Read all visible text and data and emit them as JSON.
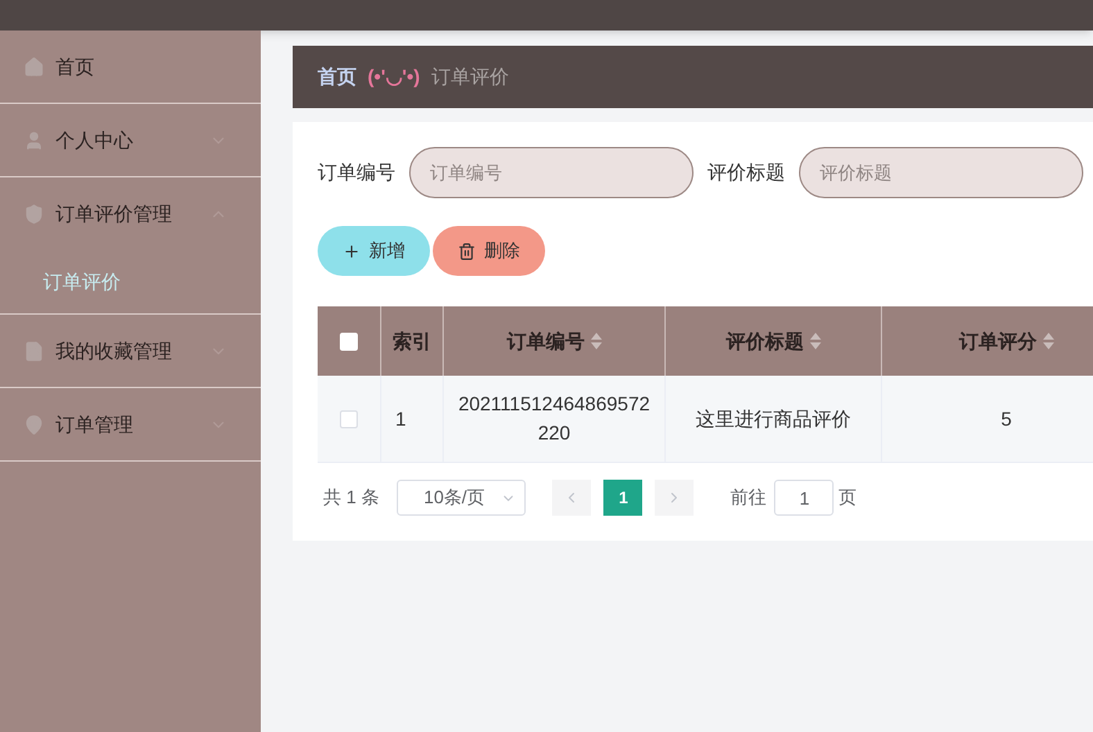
{
  "sidebar": {
    "items": [
      {
        "label": "首页",
        "expandable": false
      },
      {
        "label": "个人中心",
        "expandable": true,
        "expanded": false
      },
      {
        "label": "订单评价管理",
        "expandable": true,
        "expanded": true,
        "children": [
          {
            "label": "订单评价",
            "selected": true
          }
        ]
      },
      {
        "label": "我的收藏管理",
        "expandable": true,
        "expanded": false
      },
      {
        "label": "订单管理",
        "expandable": true,
        "expanded": false
      }
    ]
  },
  "breadcrumb": {
    "home": "首页",
    "separator": "(•'◡'•)",
    "current": "订单评价"
  },
  "search": [
    {
      "label": "订单编号",
      "placeholder": "订单编号"
    },
    {
      "label": "评价标题",
      "placeholder": "评价标题"
    }
  ],
  "buttons": [
    {
      "kind": "add",
      "label": "新增"
    },
    {
      "kind": "delete",
      "label": "删除"
    }
  ],
  "table": {
    "all_checked": false,
    "columns": [
      {
        "label": "索引",
        "sortable": false
      },
      {
        "label": "订单编号",
        "sortable": true
      },
      {
        "label": "评价标题",
        "sortable": true
      },
      {
        "label": "订单评分",
        "sortable": true
      }
    ],
    "rows": [
      {
        "checked": false,
        "cells": [
          "1",
          "202111512464869572220",
          "这里进行商品评价",
          "5"
        ]
      }
    ]
  },
  "pagination": {
    "total": "共 1 条",
    "page_size": "10条/页",
    "pages": [
      {
        "label": "1",
        "selected": true
      }
    ],
    "goto_label": "前往",
    "goto_value": "1",
    "page_suffix": "页"
  }
}
